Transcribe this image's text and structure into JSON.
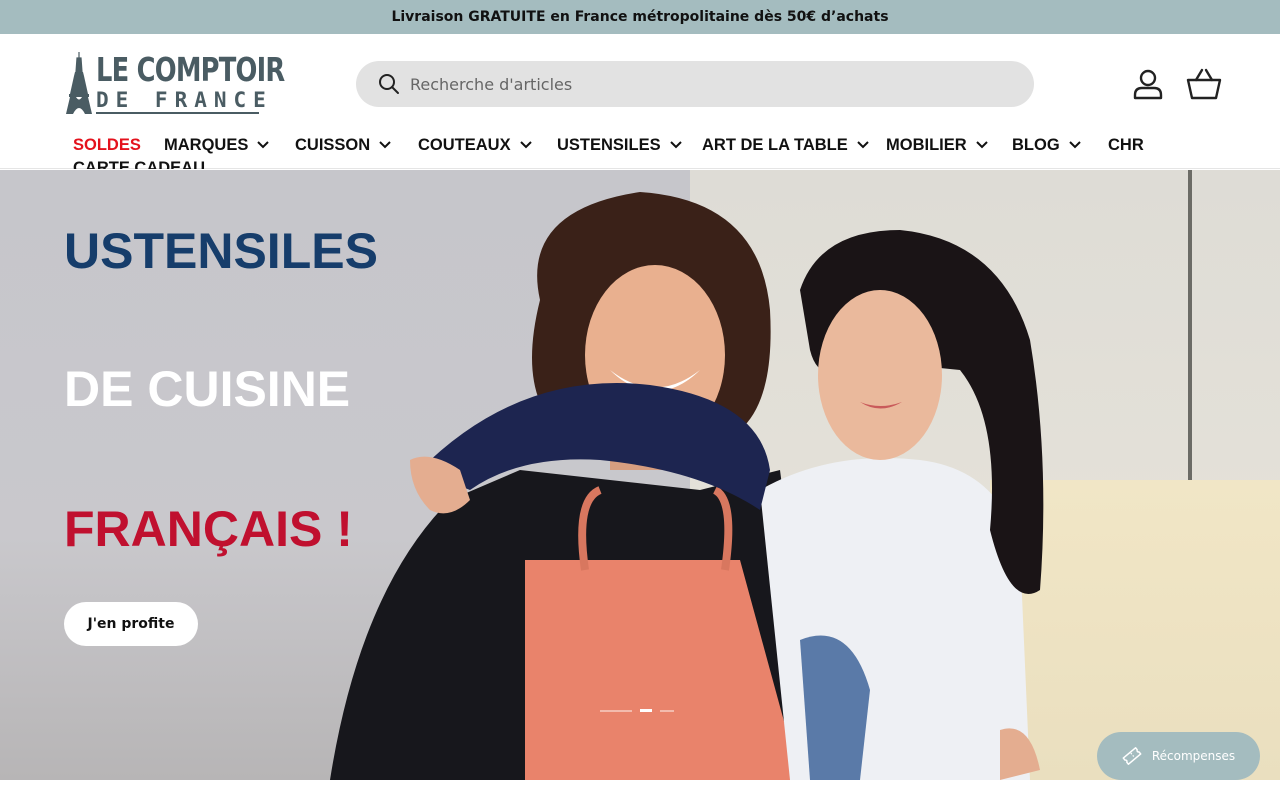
{
  "announcement": {
    "text": "Livraison GRATUITE en France métropolitaine dès 50€ d’achats"
  },
  "brand": {
    "line1": "LE COMPTOIR",
    "line2": "DE FRANCE"
  },
  "search": {
    "placeholder": "Recherche d'articles",
    "icon": "search-icon"
  },
  "header_icons": {
    "account": "user-icon",
    "cart": "basket-icon"
  },
  "nav": {
    "items": [
      {
        "label": "SOLDES",
        "dropdown": false,
        "color": "#e4121d"
      },
      {
        "label": "MARQUES",
        "dropdown": true
      },
      {
        "label": "CUISSON",
        "dropdown": true
      },
      {
        "label": "COUTEAUX",
        "dropdown": true
      },
      {
        "label": "USTENSILES",
        "dropdown": true
      },
      {
        "label": "ART DE LA TABLE",
        "dropdown": true
      },
      {
        "label": "MOBILIER",
        "dropdown": true
      },
      {
        "label": "BLOG",
        "dropdown": true
      },
      {
        "label": "CHR",
        "dropdown": false
      },
      {
        "label": "CARTE CADEAU",
        "dropdown": false
      }
    ]
  },
  "hero": {
    "line1": "USTENSILES",
    "line2": "DE CUISINE",
    "line3": "FRANÇAIS !",
    "cta": "J'en profite",
    "slides": {
      "count": 3,
      "active": 2
    },
    "colors": {
      "line1": "#163d6b",
      "line2": "#ffffff",
      "line3": "#c0102f"
    }
  },
  "rewards": {
    "label": "Récompenses",
    "icon": "ticket-icon"
  },
  "colors": {
    "accent": "#a4bcbf",
    "brand_text": "#4a5c63",
    "sale_red": "#e4121d"
  }
}
